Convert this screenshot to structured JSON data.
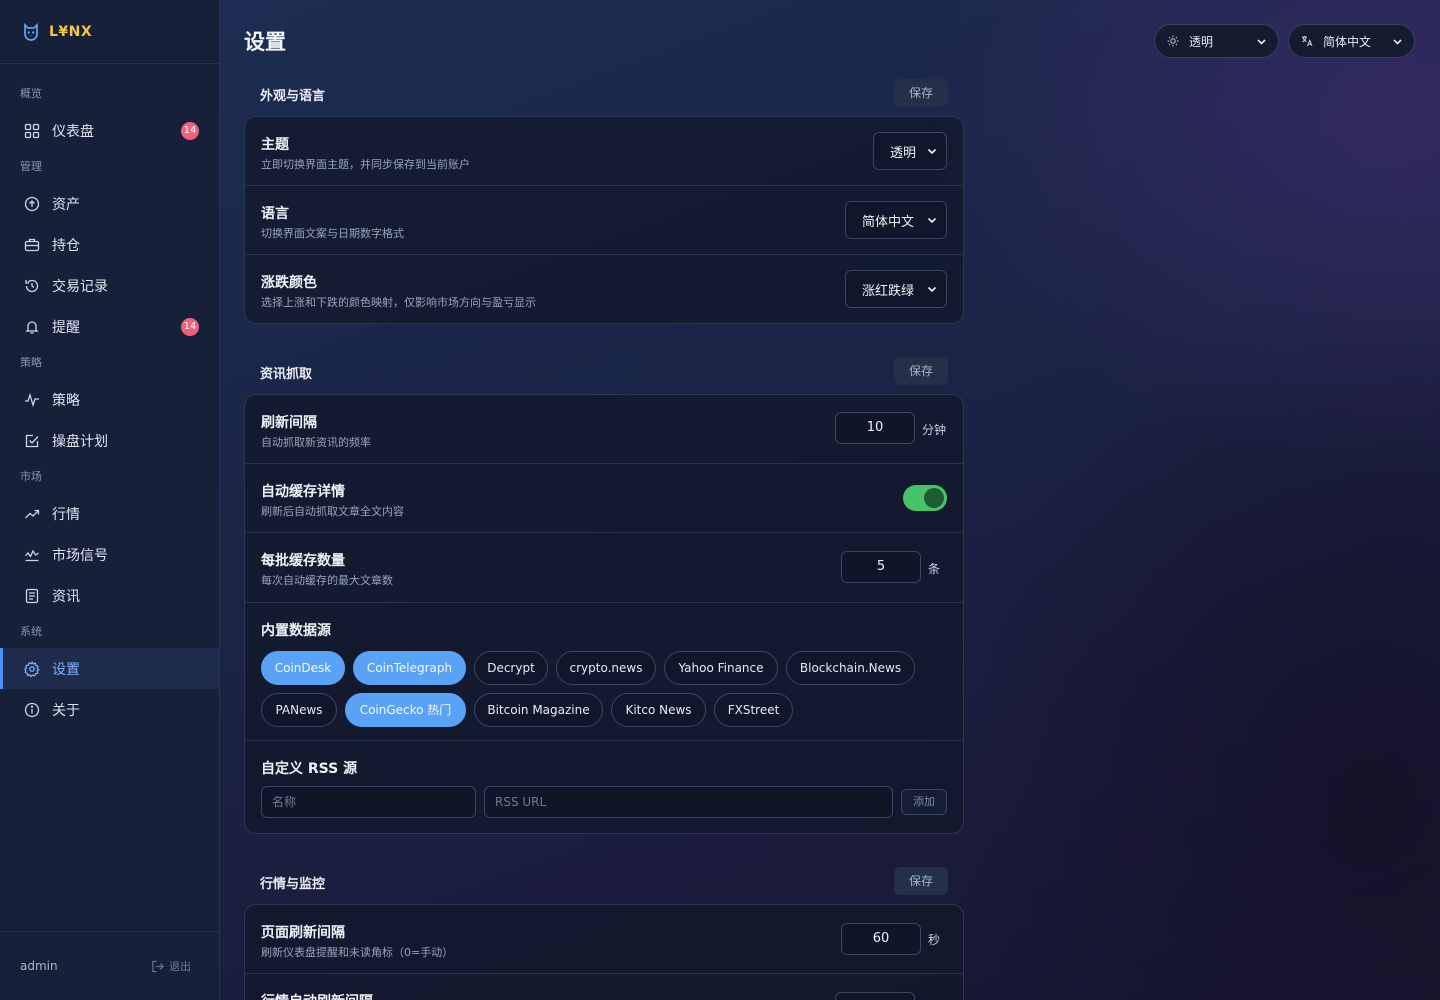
{
  "brand": {
    "name": "L¥NX"
  },
  "nav": {
    "sections": {
      "overview": "概览",
      "manage": "管理",
      "strategy": "策略",
      "market": "市场",
      "system": "系统"
    },
    "items": {
      "dashboard": {
        "label": "仪表盘",
        "badge": "14"
      },
      "assets": {
        "label": "资产"
      },
      "positions": {
        "label": "持仓"
      },
      "trades": {
        "label": "交易记录"
      },
      "alerts": {
        "label": "提醒",
        "badge": "14"
      },
      "strategies": {
        "label": "策略"
      },
      "plans": {
        "label": "操盘计划"
      },
      "quotes": {
        "label": "行情"
      },
      "signals": {
        "label": "市场信号"
      },
      "news": {
        "label": "资讯"
      },
      "settings": {
        "label": "设置"
      },
      "about": {
        "label": "关于"
      }
    },
    "user": "admin",
    "logout": "退出"
  },
  "header": {
    "title": "设置",
    "theme_select": "透明",
    "lang_select": "简体中文"
  },
  "appearance": {
    "title": "外观与语言",
    "save": "保存",
    "theme": {
      "title": "主题",
      "desc": "立即切换界面主题，并同步保存到当前账户",
      "value": "透明"
    },
    "language": {
      "title": "语言",
      "desc": "切换界面文案与日期数字格式",
      "value": "简体中文"
    },
    "color": {
      "title": "涨跌颜色",
      "desc": "选择上涨和下跌的颜色映射，仅影响市场方向与盈亏显示",
      "value": "涨红跌绿"
    }
  },
  "news_fetch": {
    "title": "资讯抓取",
    "save": "保存",
    "interval": {
      "title": "刷新间隔",
      "desc": "自动抓取新资讯的频率",
      "value": "10",
      "unit": "分钟"
    },
    "auto_cache": {
      "title": "自动缓存详情",
      "desc": "刷新后自动抓取文章全文内容",
      "enabled": true
    },
    "batch": {
      "title": "每批缓存数量",
      "desc": "每次自动缓存的最大文章数",
      "value": "5",
      "unit": "条"
    },
    "sources": {
      "title": "内置数据源",
      "items": [
        {
          "label": "CoinDesk",
          "on": true
        },
        {
          "label": "CoinTelegraph",
          "on": true
        },
        {
          "label": "Decrypt",
          "on": false
        },
        {
          "label": "crypto.news",
          "on": false
        },
        {
          "label": "Yahoo Finance",
          "on": false
        },
        {
          "label": "Blockchain.News",
          "on": false
        },
        {
          "label": "PANews",
          "on": false
        },
        {
          "label": "CoinGecko 热门",
          "on": true
        },
        {
          "label": "Bitcoin Magazine",
          "on": false
        },
        {
          "label": "Kitco News",
          "on": false
        },
        {
          "label": "FXStreet",
          "on": false
        }
      ]
    },
    "rss": {
      "title": "自定义 RSS 源",
      "name_placeholder": "名称",
      "url_placeholder": "RSS URL",
      "add": "添加"
    }
  },
  "monitor": {
    "title": "行情与监控",
    "save": "保存",
    "page_refresh": {
      "title": "页面刷新间隔",
      "desc": "刷新仪表盘提醒和未读角标（0=手动）",
      "value": "60",
      "unit": "秒"
    },
    "quote_refresh": {
      "title": "行情自动刷新间隔"
    }
  },
  "colors": {
    "accent": "#4f8ff7",
    "chip_on": "#5aa2f5",
    "toggle_on": "#47c46a",
    "badge": "#f25f7a",
    "brand": "#f5c542"
  },
  "icons": {
    "dashboard": "grid-icon",
    "assets": "upload-circle-icon",
    "positions": "briefcase-icon",
    "trades": "history-icon",
    "alerts": "bell-icon",
    "strategies": "pulse-icon",
    "plans": "checklist-icon",
    "quotes": "trend-up-icon",
    "signals": "signal-icon",
    "news": "newspaper-icon",
    "settings": "gear-icon",
    "about": "info-icon"
  }
}
